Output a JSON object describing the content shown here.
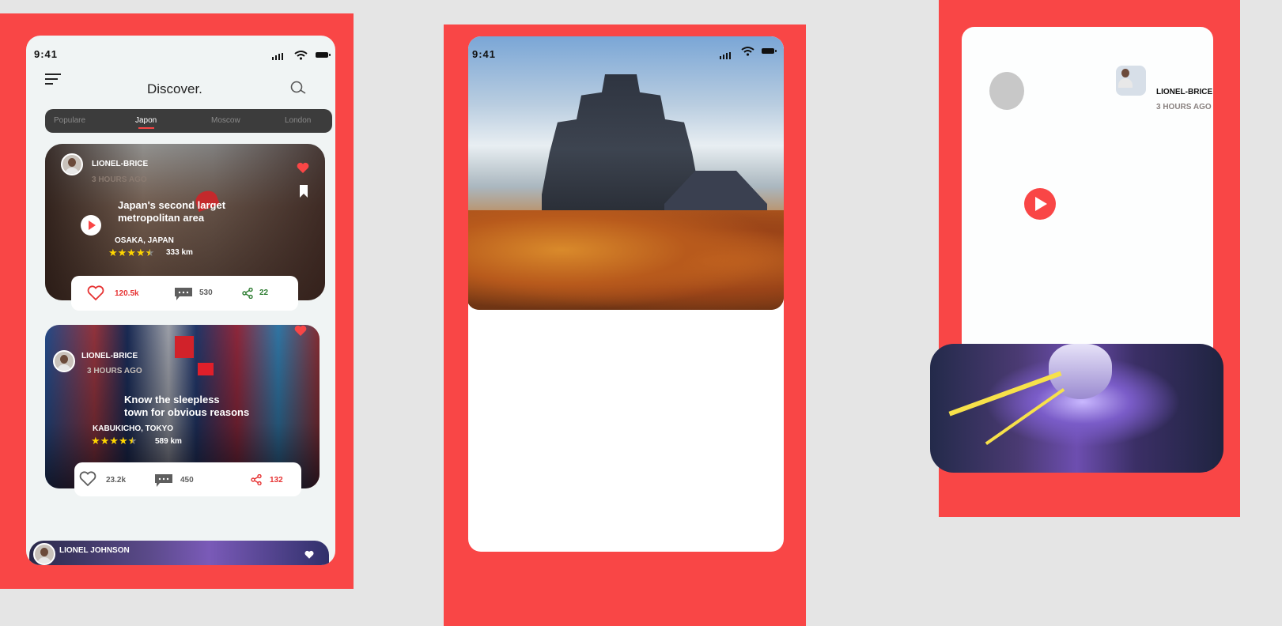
{
  "screen1": {
    "status_time": "9:41",
    "title": "Discover.",
    "tabs": [
      {
        "label": "Populare",
        "active": false
      },
      {
        "label": "Japon",
        "active": true
      },
      {
        "label": "Moscow",
        "active": false
      },
      {
        "label": "London",
        "active": false
      }
    ],
    "cards": [
      {
        "author": "LIONEL-BRICE",
        "time_ago": "3 HOURS AGO",
        "title_line1": "Japan's second larget",
        "title_line2": "metropolitan area",
        "place": "OSAKA, JAPAN",
        "rating": 4.5,
        "distance": "333 km",
        "likes": "120.5k",
        "comments": "530",
        "shares": "22"
      },
      {
        "author": "LIONEL-BRICE",
        "time_ago": "3 HOURS AGO",
        "title_line1": "Know the sleepless",
        "title_line2": "town for obvious reasons",
        "place": "KABUKICHO, TOKYO",
        "rating": 4.5,
        "distance": "589 km",
        "likes": "23.2k",
        "comments": "450",
        "shares": "132"
      },
      {
        "author": "LIONEL JOHNSON"
      }
    ]
  },
  "screen2": {
    "status_time": "9:41"
  },
  "screen3": {
    "author": "LIONEL-BRICE",
    "time_ago": "3 HOURS AGO"
  },
  "colors": {
    "accent": "#f94646",
    "like_red": "#e63232",
    "share_green": "#2e7d32",
    "star": "#ffd600",
    "tab_bar": "#3c3c3c"
  }
}
